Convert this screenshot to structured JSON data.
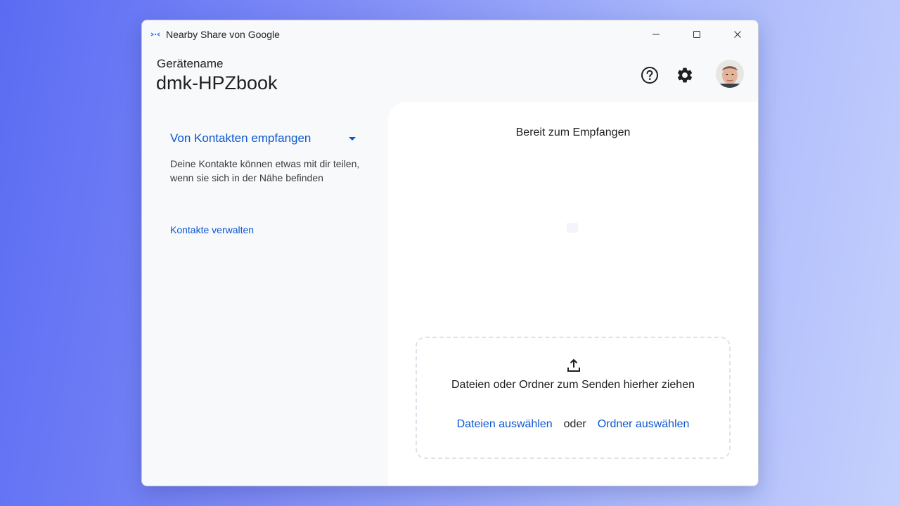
{
  "window": {
    "title": "Nearby Share von Google",
    "app_icon": "nearby-share-icon",
    "controls": [
      "minimize-icon",
      "maximize-icon",
      "close-icon"
    ]
  },
  "header": {
    "device_label": "Gerätename",
    "device_name": "dmk-HPZbook",
    "icons": [
      "help-icon",
      "settings-gear-icon"
    ],
    "avatar": "user-avatar"
  },
  "sidebar": {
    "dropdown_label": "Von Kontakten empfangen",
    "description": "Deine Kontakte können etwas mit dir teilen, wenn sie sich in der Nähe befinden",
    "manage_link": "Kontakte verwalten"
  },
  "main": {
    "status": "Bereit zum Empfangen",
    "drop_zone": {
      "icon": "upload-icon",
      "text": "Dateien oder Ordner zum Senden hierher ziehen",
      "select_files": "Dateien auswählen",
      "or": "oder",
      "select_folder": "Ordner auswählen"
    }
  },
  "colors": {
    "accent": "#0b57d0",
    "background_gradient_start": "#5b6cf3",
    "background_gradient_end": "#c4d0fc"
  }
}
